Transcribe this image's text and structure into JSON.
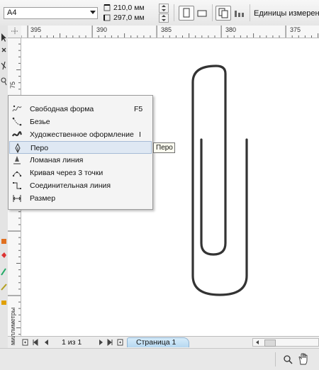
{
  "propbar": {
    "paper_size": "A4",
    "width_value": "210,0 мм",
    "height_value": "297,0 мм",
    "units_label": "Единицы измерения:"
  },
  "ruler": {
    "h_ticks": [
      "395",
      "390",
      "385",
      "380",
      "375"
    ],
    "v_ticks": [
      "75"
    ],
    "units": "миллиметры"
  },
  "flyout": {
    "items": [
      {
        "label": "Свободная форма",
        "shortcut": "F5",
        "icon": "freehand-icon"
      },
      {
        "label": "Безье",
        "shortcut": "",
        "icon": "bezier-icon"
      },
      {
        "label": "Художественное оформление",
        "shortcut": "I",
        "icon": "artistic-media-icon"
      },
      {
        "label": "Перо",
        "shortcut": "",
        "icon": "pen-icon"
      },
      {
        "label": "Ломаная линия",
        "shortcut": "",
        "icon": "polyline-icon"
      },
      {
        "label": "Кривая через 3 точки",
        "shortcut": "",
        "icon": "three-point-curve-icon"
      },
      {
        "label": "Соединительная линия",
        "shortcut": "",
        "icon": "connector-icon"
      },
      {
        "label": "Размер",
        "shortcut": "",
        "icon": "dimension-icon"
      }
    ],
    "highlighted_index": 3,
    "tooltip": "Перо"
  },
  "pagebar": {
    "page_count": "1 из 1",
    "page_tab": "Страница 1"
  }
}
